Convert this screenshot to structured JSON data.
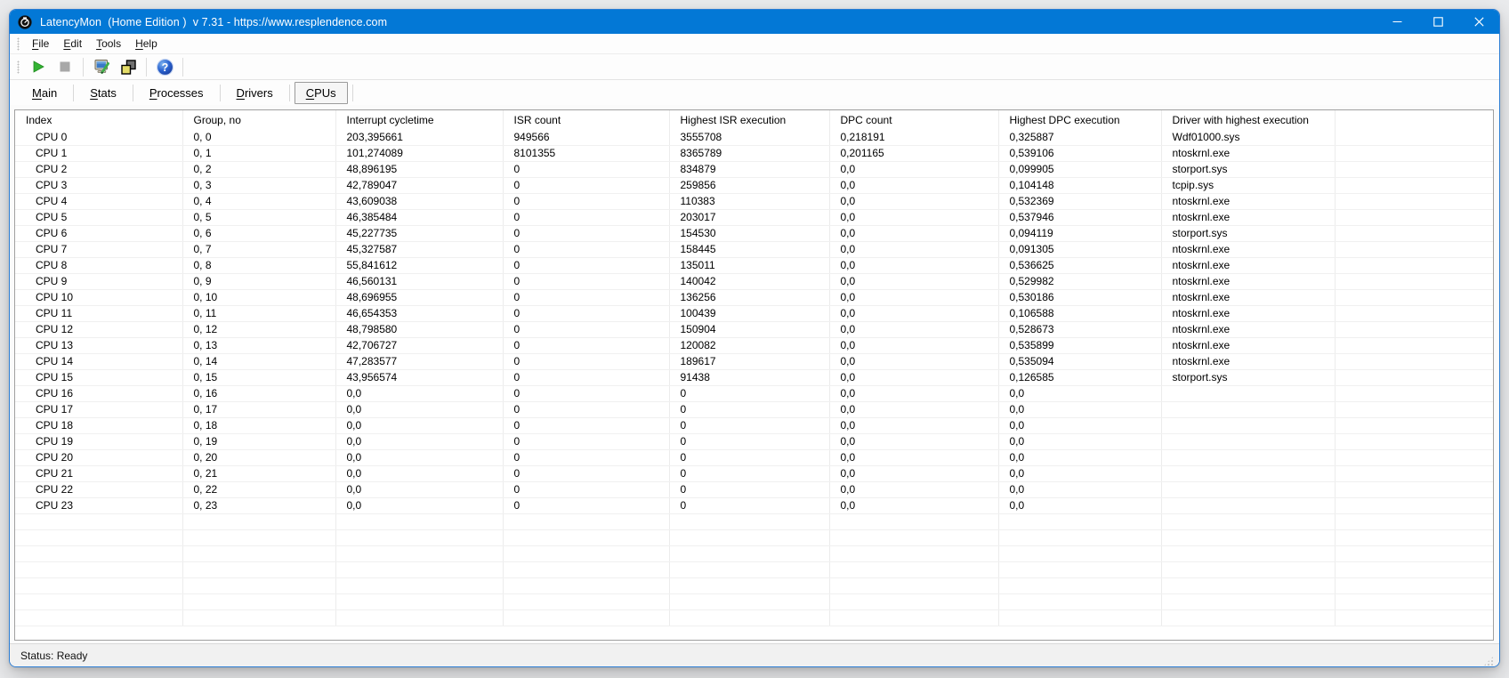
{
  "window": {
    "title": "LatencyMon  (Home Edition )  v 7.31 - https://www.resplendence.com"
  },
  "menu": {
    "items": [
      {
        "u": "F",
        "rest": "ile"
      },
      {
        "u": "E",
        "rest": "dit"
      },
      {
        "u": "T",
        "rest": "ools"
      },
      {
        "u": "H",
        "rest": "elp"
      }
    ]
  },
  "toolbar": {
    "buttons": [
      "start-monitor",
      "stop-monitor",
      "report-tool",
      "copy-window",
      "help"
    ]
  },
  "tabs": {
    "items": [
      {
        "u": "M",
        "rest": "ain",
        "selected": false
      },
      {
        "u": "S",
        "rest": "tats",
        "selected": false
      },
      {
        "u": "P",
        "rest": "rocesses",
        "selected": false
      },
      {
        "u": "D",
        "rest": "rivers",
        "selected": false
      },
      {
        "u": "C",
        "rest": "PUs",
        "selected": true
      }
    ]
  },
  "table": {
    "headers": [
      "Index",
      "Group, no",
      "Interrupt cycletime",
      "ISR count",
      "Highest ISR execution",
      "DPC count",
      "Highest DPC execution",
      "Driver with highest execution"
    ],
    "rows": [
      [
        "CPU 0",
        "0, 0",
        "203,395661",
        "949566",
        "3555708",
        "0,218191",
        "0,325887",
        "Wdf01000.sys"
      ],
      [
        "CPU 1",
        "0, 1",
        "101,274089",
        "8101355",
        "8365789",
        "0,201165",
        "0,539106",
        "ntoskrnl.exe"
      ],
      [
        "CPU 2",
        "0, 2",
        "48,896195",
        "0",
        "834879",
        "0,0",
        "0,099905",
        "storport.sys"
      ],
      [
        "CPU 3",
        "0, 3",
        "42,789047",
        "0",
        "259856",
        "0,0",
        "0,104148",
        "tcpip.sys"
      ],
      [
        "CPU 4",
        "0, 4",
        "43,609038",
        "0",
        "110383",
        "0,0",
        "0,532369",
        "ntoskrnl.exe"
      ],
      [
        "CPU 5",
        "0, 5",
        "46,385484",
        "0",
        "203017",
        "0,0",
        "0,537946",
        "ntoskrnl.exe"
      ],
      [
        "CPU 6",
        "0, 6",
        "45,227735",
        "0",
        "154530",
        "0,0",
        "0,094119",
        "storport.sys"
      ],
      [
        "CPU 7",
        "0, 7",
        "45,327587",
        "0",
        "158445",
        "0,0",
        "0,091305",
        "ntoskrnl.exe"
      ],
      [
        "CPU 8",
        "0, 8",
        "55,841612",
        "0",
        "135011",
        "0,0",
        "0,536625",
        "ntoskrnl.exe"
      ],
      [
        "CPU 9",
        "0, 9",
        "46,560131",
        "0",
        "140042",
        "0,0",
        "0,529982",
        "ntoskrnl.exe"
      ],
      [
        "CPU 10",
        "0, 10",
        "48,696955",
        "0",
        "136256",
        "0,0",
        "0,530186",
        "ntoskrnl.exe"
      ],
      [
        "CPU 11",
        "0, 11",
        "46,654353",
        "0",
        "100439",
        "0,0",
        "0,106588",
        "ntoskrnl.exe"
      ],
      [
        "CPU 12",
        "0, 12",
        "48,798580",
        "0",
        "150904",
        "0,0",
        "0,528673",
        "ntoskrnl.exe"
      ],
      [
        "CPU 13",
        "0, 13",
        "42,706727",
        "0",
        "120082",
        "0,0",
        "0,535899",
        "ntoskrnl.exe"
      ],
      [
        "CPU 14",
        "0, 14",
        "47,283577",
        "0",
        "189617",
        "0,0",
        "0,535094",
        "ntoskrnl.exe"
      ],
      [
        "CPU 15",
        "0, 15",
        "43,956574",
        "0",
        "91438",
        "0,0",
        "0,126585",
        "storport.sys"
      ],
      [
        "CPU 16",
        "0, 16",
        "0,0",
        "0",
        "0",
        "0,0",
        "0,0",
        ""
      ],
      [
        "CPU 17",
        "0, 17",
        "0,0",
        "0",
        "0",
        "0,0",
        "0,0",
        ""
      ],
      [
        "CPU 18",
        "0, 18",
        "0,0",
        "0",
        "0",
        "0,0",
        "0,0",
        ""
      ],
      [
        "CPU 19",
        "0, 19",
        "0,0",
        "0",
        "0",
        "0,0",
        "0,0",
        ""
      ],
      [
        "CPU 20",
        "0, 20",
        "0,0",
        "0",
        "0",
        "0,0",
        "0,0",
        ""
      ],
      [
        "CPU 21",
        "0, 21",
        "0,0",
        "0",
        "0",
        "0,0",
        "0,0",
        ""
      ],
      [
        "CPU 22",
        "0, 22",
        "0,0",
        "0",
        "0",
        "0,0",
        "0,0",
        ""
      ],
      [
        "CPU 23",
        "0, 23",
        "0,0",
        "0",
        "0",
        "0,0",
        "0,0",
        ""
      ]
    ],
    "empty_row_count": 7
  },
  "statusbar": {
    "text": "Status: Ready"
  },
  "colors": {
    "titlebar": "#0378d6",
    "window_border": "#2b7cd3",
    "start_green": "#33b333",
    "stop_gray": "#a8a8a8",
    "help_blue": "#2a63d0"
  }
}
